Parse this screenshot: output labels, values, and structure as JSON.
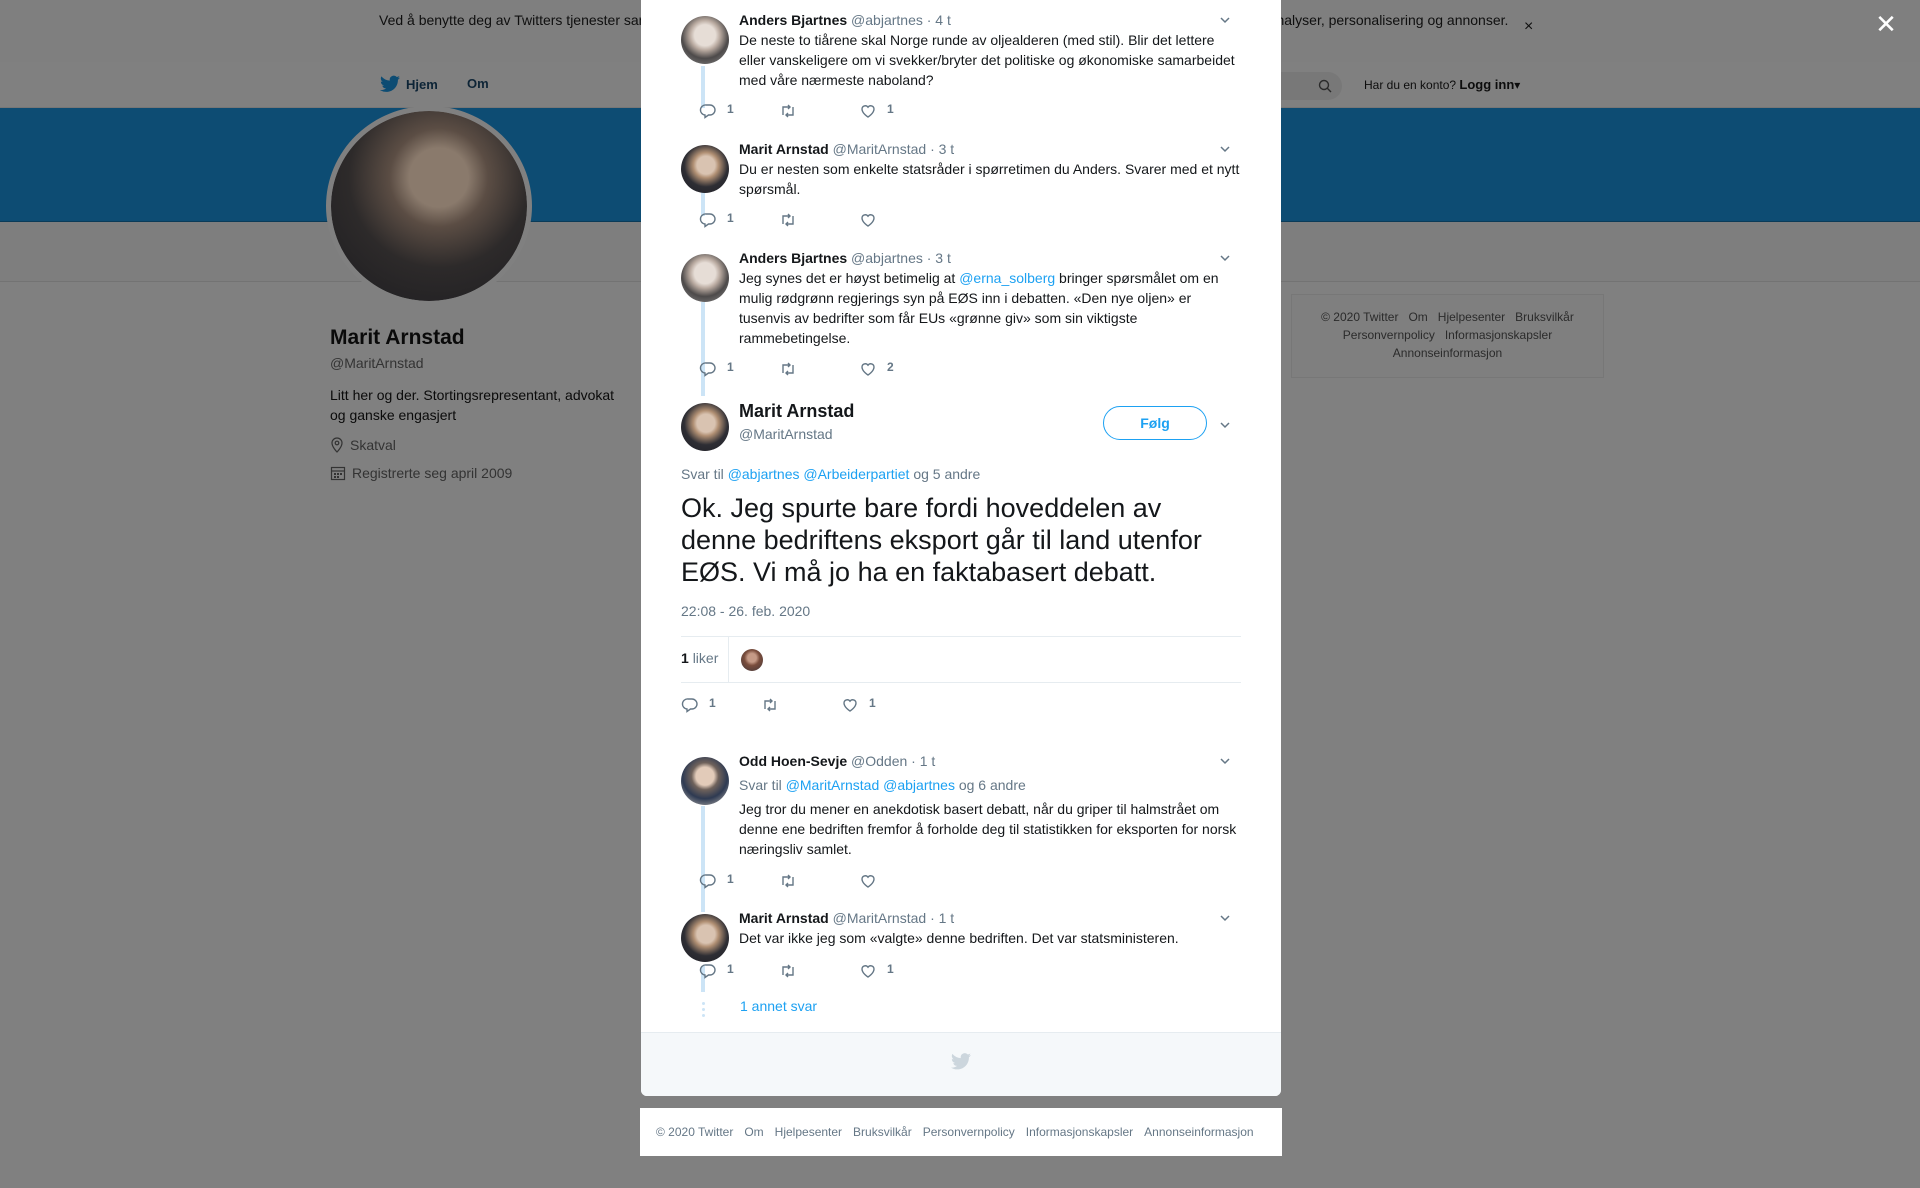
{
  "cookie_banner": {
    "text": "Ved å benytte deg av Twitters tjenester samtykker du til vår bruk av informasjonskapsler. Vi og våre partnere bruker informasjonskapsler til bl.a. analyser, personalisering og annonser.",
    "close": "×"
  },
  "nav": {
    "home": "Hjem",
    "about": "Om",
    "has_account": "Har du en konto?",
    "login": "Logg inn"
  },
  "profile": {
    "name": "Marit Arnstad",
    "handle": "@MaritArnstad",
    "bio": "Litt her og der. Stortingsrepresentant, advokat og ganske engasjert",
    "location": "Skatval",
    "joined": "Registrerte seg april 2009"
  },
  "side_footer": {
    "links": [
      "© 2020 Twitter",
      "Om",
      "Hjelpesenter",
      "Bruksvilkår",
      "Personvernpolicy",
      "Informasjonskapsler",
      "Annonseinformasjon"
    ]
  },
  "modal_close": "✕",
  "thread": [
    {
      "name": "Anders Bjartnes",
      "handle": "@abjartnes",
      "time": "· 4 t",
      "text": "De neste to tiårene skal Norge runde av oljealderen (med stil). Blir det lettere eller vanskeligere om vi svekker/bryter det politiske og økonomiske samarbeidet med våre nærmeste naboland?",
      "replies": "1",
      "retweets": "",
      "likes": "1"
    },
    {
      "name": "Marit Arnstad",
      "handle": "@MaritArnstad",
      "time": "· 3 t",
      "text": "Du er nesten som enkelte statsråder i spørretimen du Anders. Svarer med et nytt spørsmål.",
      "replies": "1",
      "retweets": "",
      "likes": ""
    },
    {
      "name": "Anders Bjartnes",
      "handle": "@abjartnes",
      "time": "· 3 t",
      "text_before": "Jeg synes det er høyst betimelig at ",
      "mention": "@erna_solberg",
      "text_after": " bringer spørsmålet om en mulig rødgrønn regjerings syn på EØS inn i debatten. «Den nye oljen» er tusenvis av bedrifter som får EUs «grønne giv» som sin viktigste rammebetingelse.",
      "replies": "1",
      "retweets": "",
      "likes": "2"
    }
  ],
  "main_tweet": {
    "name": "Marit Arnstad",
    "handle": "@MaritArnstad",
    "follow": "Følg",
    "reply_prefix": "Svar til",
    "reply_mentions": "@abjartnes @Arbeiderpartiet",
    "reply_suffix": "og 5 andre",
    "text": "Ok. Jeg spurte bare fordi hoveddelen av denne bedriftens eksport går til land utenfor EØS. Vi må jo ha en faktabasert debatt.",
    "timestamp": "22:08 - 26. feb. 2020",
    "like_count": "1",
    "like_label": "liker",
    "replies": "1",
    "retweets": "",
    "likes": "1"
  },
  "replies": [
    {
      "name": "Odd Hoen-Sevje",
      "handle": "@Odden",
      "time": "· 1 t",
      "reply_prefix": "Svar til",
      "reply_mentions": "@MaritArnstad @abjartnes",
      "reply_suffix": "og 6 andre",
      "text": "Jeg tror du mener en anekdotisk basert debatt, når du griper til halmstrået om denne ene bedriften fremfor å forholde deg til statistikken for eksporten for norsk næringsliv samlet.",
      "replies": "1",
      "retweets": "",
      "likes": ""
    },
    {
      "name": "Marit Arnstad",
      "handle": "@MaritArnstad",
      "time": "· 1 t",
      "text": "Det var ikke jeg som «valgte» denne bedriften. Det var statsministeren.",
      "replies": "1",
      "retweets": "",
      "likes": "1"
    }
  ],
  "more_replies": "1 annet svar",
  "bottom_footer": {
    "links": [
      "© 2020 Twitter",
      "Om",
      "Hjelpesenter",
      "Bruksvilkår",
      "Personvernpolicy",
      "Informasjonskapsler",
      "Annonseinformasjon"
    ]
  },
  "colors": {
    "accent": "#1da1f2",
    "thread_line": "#cce4f6",
    "muted": "#657786"
  }
}
